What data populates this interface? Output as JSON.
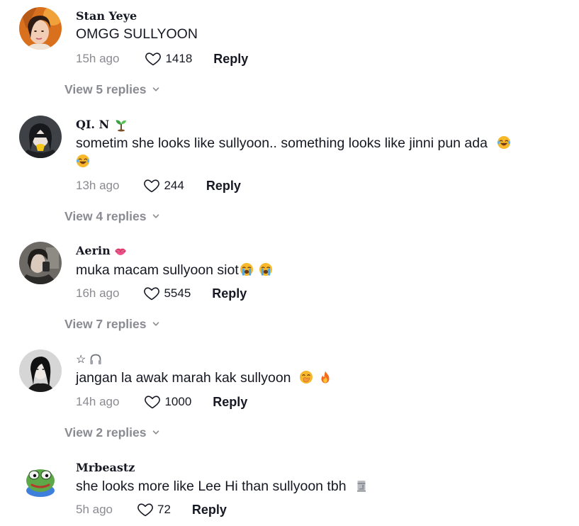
{
  "reply_label": "Reply",
  "comments": [
    {
      "username": "Stan Yeye",
      "text": "OMGG SULLYOON",
      "time": "15h ago",
      "likes": "1418",
      "view_replies": "View 5 replies",
      "avatar_icon": "profile-photo"
    },
    {
      "username": "QI. N",
      "name_emoji": "seedling-icon",
      "text": "sometim she looks like sullyoon.. something looks like jinni pun ada",
      "text_emojis": [
        "tears-of-joy-icon",
        "tears-of-joy-icon"
      ],
      "time": "13h ago",
      "likes": "244",
      "view_replies": "View 4 replies"
    },
    {
      "username": "Aerin",
      "name_emoji": "kiss-mark-icon",
      "text": "muka macam sullyoon siot",
      "text_emojis": [
        "loudly-crying-icon",
        "loudly-crying-icon"
      ],
      "time": "16h ago",
      "likes": "5545",
      "view_replies": "View 7 replies"
    },
    {
      "username": "☆",
      "name_emoji": "headphone-icon",
      "text": "jangan la awak marah kak sullyoon",
      "text_emojis": [
        "hand-over-mouth-icon",
        "fire-icon"
      ],
      "time": "14h ago",
      "likes": "1000",
      "view_replies": "View 2 replies"
    },
    {
      "username": "Mrbeastz",
      "text": "she looks more like Lee Hi than sullyoon tbh",
      "text_emojis": [
        "moai-icon"
      ],
      "time": "5h ago",
      "likes": "72"
    }
  ]
}
